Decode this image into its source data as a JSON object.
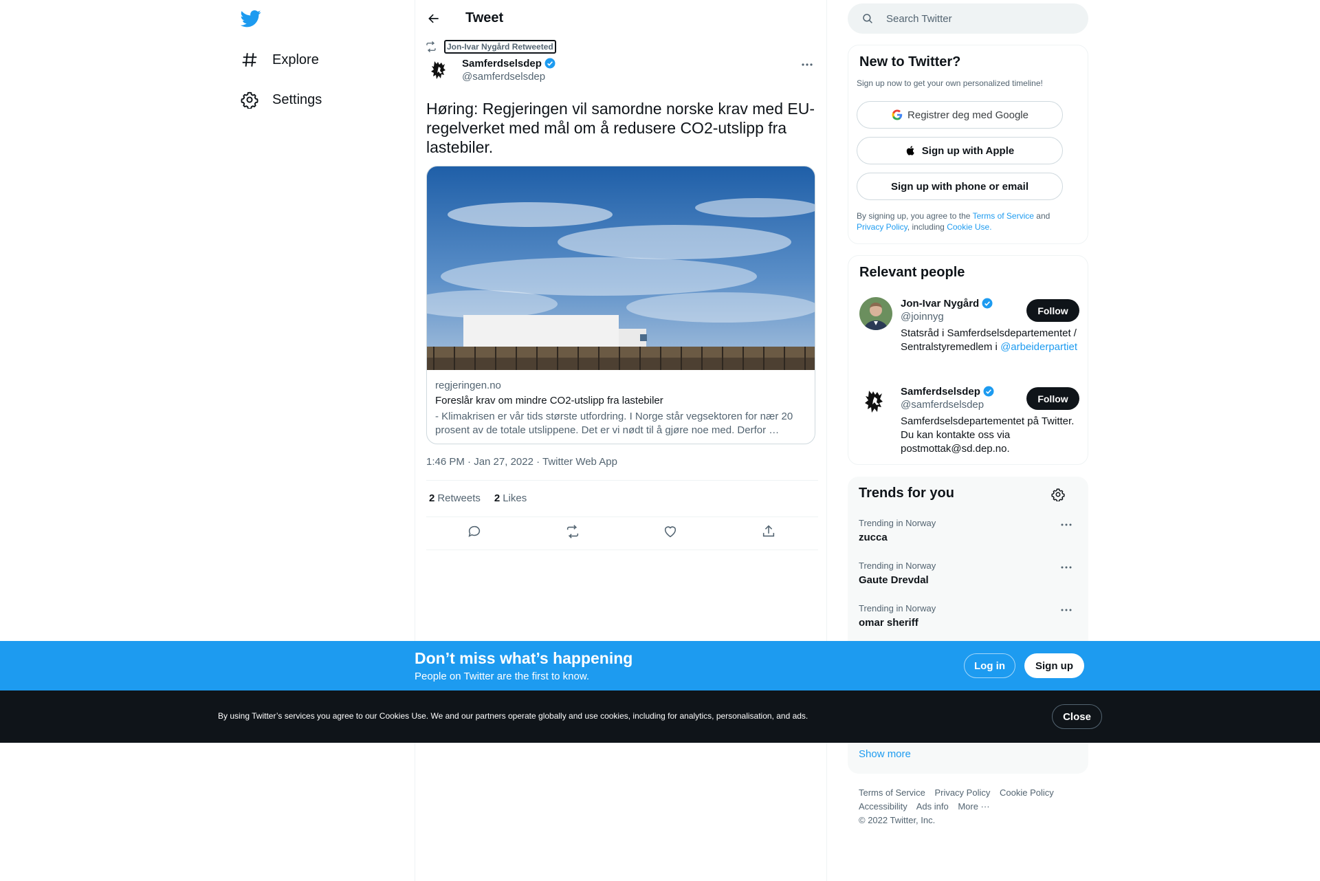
{
  "nav": {
    "items": [
      {
        "label": "Explore",
        "icon": "hashtag-icon"
      },
      {
        "label": "Settings",
        "icon": "gear-icon"
      }
    ]
  },
  "header": {
    "title": "Tweet"
  },
  "tweet": {
    "retweeted_by": "Jon-Ivar Nygård Retweeted",
    "author_name": "Samferdselsdep",
    "author_handle": "@samferdselsdep",
    "text": "Høring: Regjeringen vil samordne norske krav med EU-regelverket med mål om å redusere CO2-utslipp fra lastebiler.",
    "card": {
      "domain": "regjeringen.no",
      "title": "Foreslår krav om mindre CO2-utslipp fra lastebiler",
      "description": "- Klimakrisen er vår tids største utfordring. I Norge står vegsektoren for nær 20 prosent av de totale utslippene. Det er vi nødt til å gjøre noe med. Derfor …"
    },
    "timestamp": "1:46 PM · Jan 27, 2022 · Twitter Web App",
    "retweets_count": "2",
    "retweets_label": "Retweets",
    "likes_count": "2",
    "likes_label": "Likes"
  },
  "search": {
    "placeholder": "Search Twitter"
  },
  "signup_box": {
    "title": "New to Twitter?",
    "subtitle": "Sign up now to get your own personalized timeline!",
    "google_label": "Registrer deg med Google",
    "apple_label": "Sign up with Apple",
    "phone_label": "Sign up with phone or email",
    "terms_prefix": "By signing up, you agree to the",
    "terms_link": "Terms of Service",
    "terms_and": "and",
    "privacy_link": "Privacy Policy",
    "terms_including": ", including",
    "cookie_link": "Cookie Use."
  },
  "people": {
    "title": "Relevant people",
    "items": [
      {
        "name": "Jon-Ivar Nygård",
        "handle": "@joinnyg",
        "bio": "Statsråd i Samferdselsdepartementet / Sentralstyremedlem i",
        "bio_link": "@arbeiderpartiet",
        "follow_label": "Follow"
      },
      {
        "name": "Samferdselsdep",
        "handle": "@samferdselsdep",
        "bio": "Samferdselsdepartementet på Twitter. Du kan kontakte oss via postmottak@sd.dep.no.",
        "follow_label": "Follow"
      }
    ]
  },
  "trends": {
    "title": "Trends for you",
    "items": [
      {
        "category": "Trending in Norway",
        "name": "zucca"
      },
      {
        "category": "Trending in Norway",
        "name": "Gaute Drevdal"
      },
      {
        "category": "Trending in Norway",
        "name": "omar sheriff"
      }
    ],
    "show_more": "Show more"
  },
  "footer": {
    "links": [
      "Terms of Service",
      "Privacy Policy",
      "Cookie Policy",
      "Accessibility",
      "Ads info",
      "More ···"
    ],
    "copyright": "© 2022 Twitter, Inc."
  },
  "bottom_bar": {
    "title": "Don’t miss what’s happening",
    "subtitle": "People on Twitter are the first to know.",
    "login_label": "Log in",
    "signup_label": "Sign up"
  },
  "cookie_bar": {
    "text": "By using Twitter’s services you agree to our Cookies Use. We and our partners operate globally and use cookies, including for analytics, personalisation, and ads.",
    "close_label": "Close"
  },
  "colors": {
    "accent": "#1d9bf0",
    "text": "#0f1419",
    "secondary_text": "#536471",
    "cookie_bg": "#0f1419"
  }
}
